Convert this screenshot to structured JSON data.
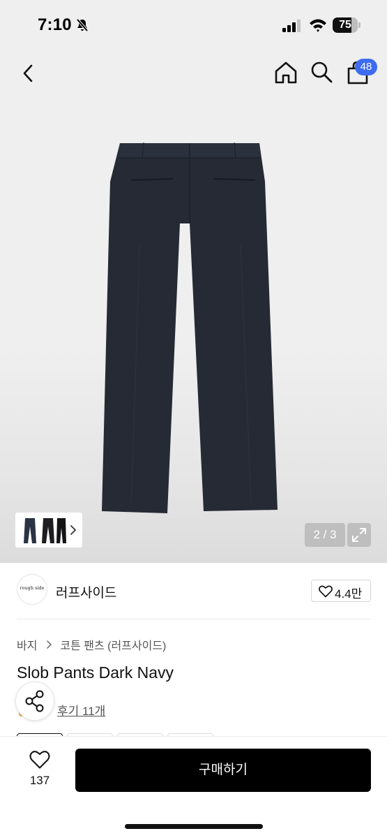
{
  "status_bar": {
    "time": "7:10",
    "battery_level": 75,
    "battery_label": "75"
  },
  "header": {
    "cart_count": "48",
    "icons": [
      "back-icon",
      "home-icon",
      "search-icon",
      "cart-icon"
    ]
  },
  "gallery": {
    "page_indicator": "2 / 3",
    "current_index": 2,
    "total": 3
  },
  "shop": {
    "logo_text": "rough side",
    "name": "러프사이드",
    "follower_count": "4.4만"
  },
  "product": {
    "breadcrumb": [
      "바지",
      "코튼 팬츠 (러프사이드)"
    ],
    "title": "Slob Pants Dark Navy",
    "review_link": "후기 11개"
  },
  "bottom_bar": {
    "like_count": "137",
    "buy_label": "구매하기"
  },
  "colors": {
    "accent_badge": "#3d6cf0",
    "buy_button": "#000000",
    "rating_star": "#f2a233",
    "pants": "#252a34"
  }
}
